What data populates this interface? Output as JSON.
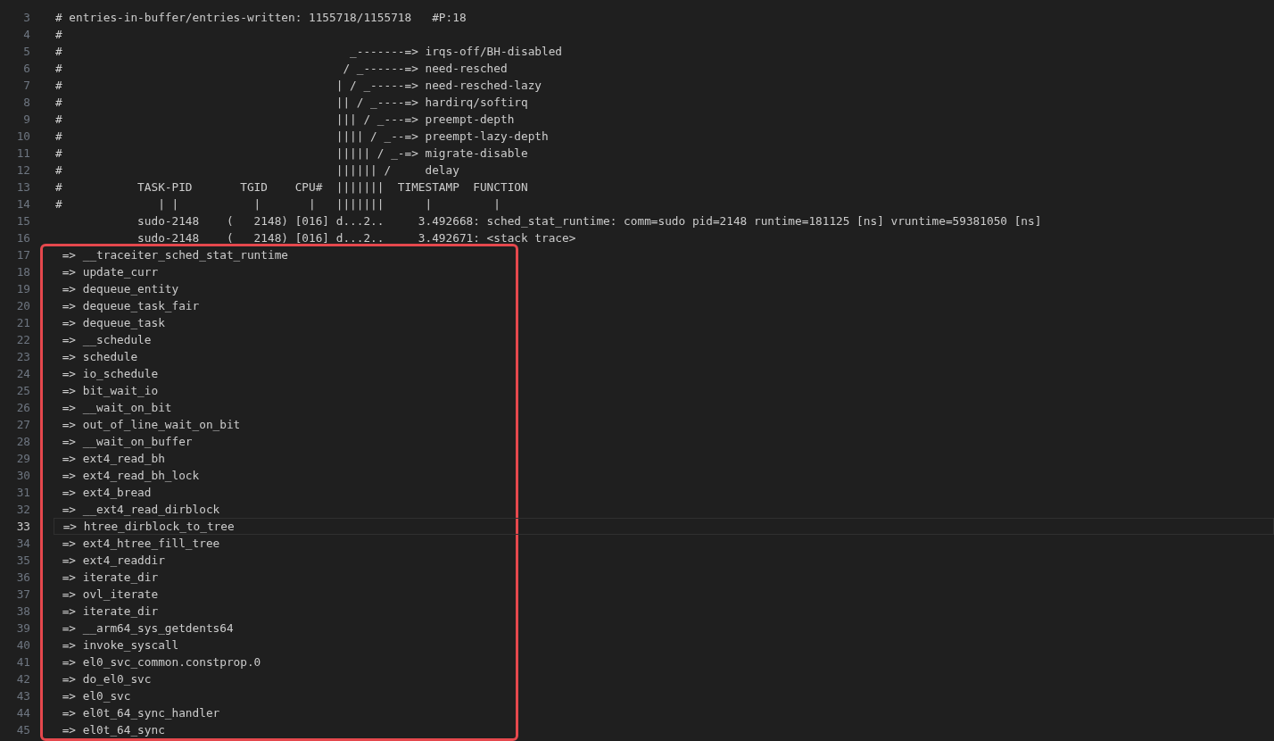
{
  "editor": {
    "lines": [
      {
        "number": "3",
        "text": "# entries-in-buffer/entries-written: 1155718/1155718   #P:18",
        "current": false
      },
      {
        "number": "4",
        "text": "#",
        "current": false
      },
      {
        "number": "5",
        "text": "#                                          _-------=> irqs-off/BH-disabled",
        "current": false
      },
      {
        "number": "6",
        "text": "#                                         / _------=> need-resched",
        "current": false
      },
      {
        "number": "7",
        "text": "#                                        | / _-----=> need-resched-lazy",
        "current": false
      },
      {
        "number": "8",
        "text": "#                                        || / _----=> hardirq/softirq",
        "current": false
      },
      {
        "number": "9",
        "text": "#                                        ||| / _---=> preempt-depth",
        "current": false
      },
      {
        "number": "10",
        "text": "#                                        |||| / _--=> preempt-lazy-depth",
        "current": false
      },
      {
        "number": "11",
        "text": "#                                        ||||| / _-=> migrate-disable",
        "current": false
      },
      {
        "number": "12",
        "text": "#                                        |||||| /     delay",
        "current": false
      },
      {
        "number": "13",
        "text": "#           TASK-PID       TGID    CPU#  |||||||  TIMESTAMP  FUNCTION",
        "current": false
      },
      {
        "number": "14",
        "text": "#              | |           |       |   |||||||      |         |",
        "current": false
      },
      {
        "number": "15",
        "text": "            sudo-2148    (   2148) [016] d...2..     3.492668: sched_stat_runtime: comm=sudo pid=2148 runtime=181125 [ns] vruntime=59381050 [ns]",
        "current": false
      },
      {
        "number": "16",
        "text": "            sudo-2148    (   2148) [016] d...2..     3.492671: <stack trace>",
        "current": false
      }
    ],
    "highlighted_block": {
      "lines": [
        {
          "number": "17",
          "text": " => __traceiter_sched_stat_runtime",
          "current": false
        },
        {
          "number": "18",
          "text": " => update_curr",
          "current": false
        },
        {
          "number": "19",
          "text": " => dequeue_entity",
          "current": false
        },
        {
          "number": "20",
          "text": " => dequeue_task_fair",
          "current": false
        },
        {
          "number": "21",
          "text": " => dequeue_task",
          "current": false
        },
        {
          "number": "22",
          "text": " => __schedule",
          "current": false
        },
        {
          "number": "23",
          "text": " => schedule",
          "current": false
        },
        {
          "number": "24",
          "text": " => io_schedule",
          "current": false
        },
        {
          "number": "25",
          "text": " => bit_wait_io",
          "current": false
        },
        {
          "number": "26",
          "text": " => __wait_on_bit",
          "current": false
        },
        {
          "number": "27",
          "text": " => out_of_line_wait_on_bit",
          "current": false
        },
        {
          "number": "28",
          "text": " => __wait_on_buffer",
          "current": false
        },
        {
          "number": "29",
          "text": " => ext4_read_bh",
          "current": false
        },
        {
          "number": "30",
          "text": " => ext4_read_bh_lock",
          "current": false
        },
        {
          "number": "31",
          "text": " => ext4_bread",
          "current": false
        },
        {
          "number": "32",
          "text": " => __ext4_read_dirblock",
          "current": false
        },
        {
          "number": "33",
          "text": " => htree_dirblock_to_tree",
          "current": true
        },
        {
          "number": "34",
          "text": " => ext4_htree_fill_tree",
          "current": false
        },
        {
          "number": "35",
          "text": " => ext4_readdir",
          "current": false
        },
        {
          "number": "36",
          "text": " => iterate_dir",
          "current": false
        },
        {
          "number": "37",
          "text": " => ovl_iterate",
          "current": false
        },
        {
          "number": "38",
          "text": " => iterate_dir",
          "current": false
        },
        {
          "number": "39",
          "text": " => __arm64_sys_getdents64",
          "current": false
        },
        {
          "number": "40",
          "text": " => invoke_syscall",
          "current": false
        },
        {
          "number": "41",
          "text": " => el0_svc_common.constprop.0",
          "current": false
        },
        {
          "number": "42",
          "text": " => do_el0_svc",
          "current": false
        },
        {
          "number": "43",
          "text": " => el0_svc",
          "current": false
        },
        {
          "number": "44",
          "text": " => el0t_64_sync_handler",
          "current": false
        },
        {
          "number": "45",
          "text": " => el0t_64_sync",
          "current": false
        }
      ]
    }
  }
}
